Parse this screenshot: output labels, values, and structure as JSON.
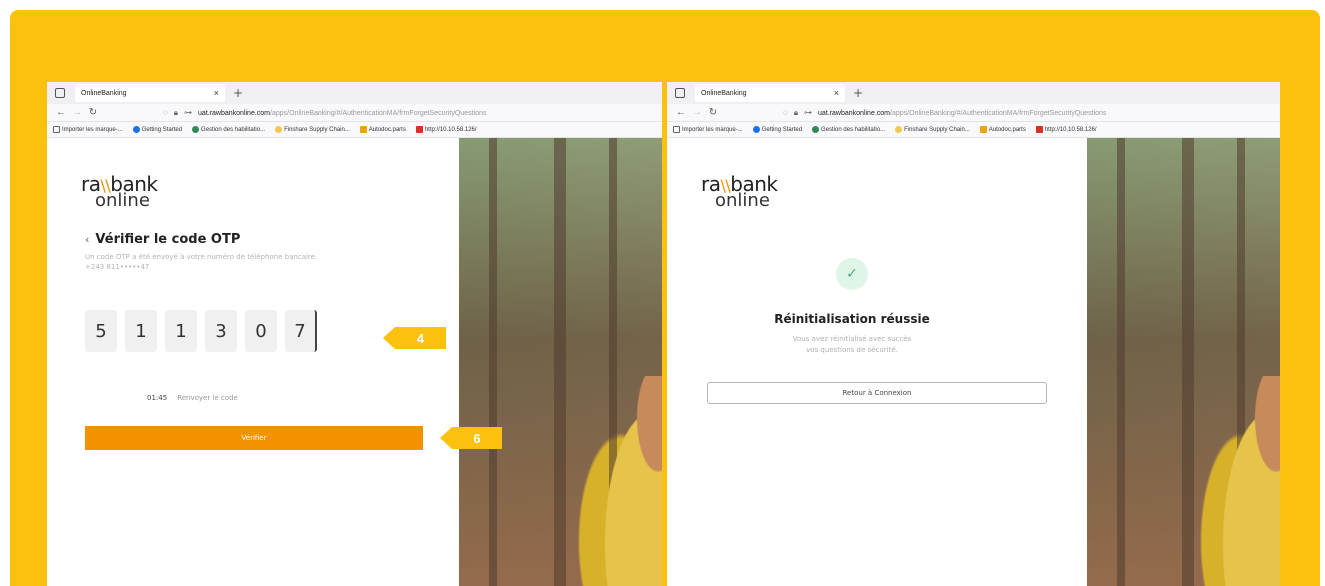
{
  "left": {
    "browser": {
      "tab_title": "OnlineBanking",
      "tab_close": "×",
      "new_tab": "+",
      "url_host": "uat.rawbankonline.com",
      "url_path": "/apps/OnlineBanking/#/AuthenticationMA/frmForgetSecurityQuestions",
      "bookmarks": [
        "Importer les marque-...",
        "Getting Started",
        "Gestion des habilitatio...",
        "Finshare Supply Chain...",
        "Autodoc.parts",
        "http://10.10.58.126/"
      ]
    },
    "logo": {
      "line1_a": "ra",
      "line1_mark": "\\\\",
      "line1_b": "bank",
      "line2": "online"
    },
    "back_chevron": "‹",
    "title": "Vérifier le code OTP",
    "description": "Un code OTP a été envoyé à votre numéro de téléphone bancaire.",
    "phone_masked": "+243 811•••••47",
    "otp_digits": [
      "5",
      "1",
      "1",
      "3",
      "0",
      "7"
    ],
    "timer": "01:45",
    "resend_label": "Renvoyer le code",
    "verify_button": "Vérifier",
    "callout_4": "4",
    "callout_6": "6"
  },
  "right": {
    "browser": {
      "tab_title": "OnlineBanking",
      "tab_close": "×",
      "new_tab": "+",
      "url_host": "uat.rawbankonline.com",
      "url_path": "/apps/OnlineBanking/#/AuthenticationMA/frmForgetSecurityQuestions",
      "bookmarks": [
        "Importer les marque-...",
        "Getting Started",
        "Gestion des habilitatio...",
        "Finshare Supply Chain...",
        "Autodoc.parts",
        "http://10.10.58.126/"
      ]
    },
    "logo": {
      "line1_a": "ra",
      "line1_mark": "\\\\",
      "line1_b": "bank",
      "line2": "online"
    },
    "check_glyph": "✓",
    "title": "Réinitialisation réussie",
    "description_1": "Vous avez réinitialisé avec succès",
    "description_2": "vos questions de sécurité.",
    "back_button": "Retour à Connexion"
  },
  "colors": {
    "frame": "#fcc10e",
    "brand_orange": "#f39200",
    "success_green": "#3cb371"
  }
}
